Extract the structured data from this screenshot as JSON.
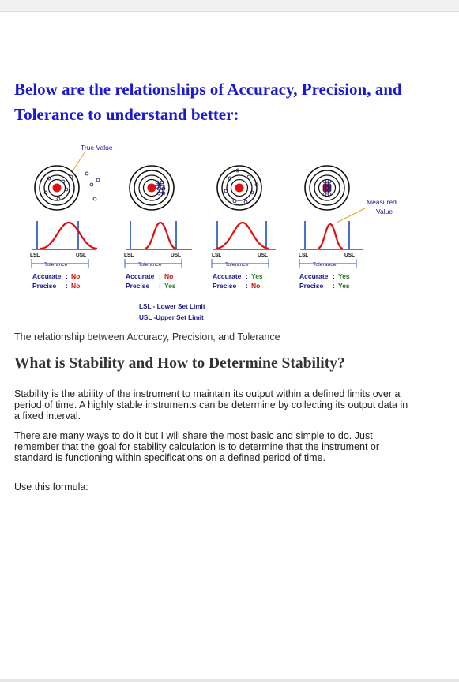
{
  "heading": "Below are the relationships of Accuracy, Precision, and Tolerance to  understand better:",
  "figure": {
    "true_value_label": "True Value",
    "measured_value_label_line1": "Measured",
    "measured_value_label_line2": "Value",
    "lsl": "LSL",
    "usl": "USL",
    "tolerance": "Tolerance",
    "accurate_label": "Accurate",
    "precise_label": "Precise",
    "panels": [
      {
        "accurate": "No",
        "precise": "No"
      },
      {
        "accurate": "No",
        "precise": "Yes"
      },
      {
        "accurate": "Yes",
        "precise": "No"
      },
      {
        "accurate": "Yes",
        "precise": "Yes"
      }
    ],
    "legend_lsl": "LSL - Lower Set Limit",
    "legend_usl": "USL -Upper Set Limit",
    "colors": {
      "yes": "#1e7a1e",
      "no": "#cc1111",
      "label": "#1a1a8c",
      "curve": "#e01010",
      "axis": "#1a4fbf",
      "annotation": "#f0a020"
    }
  },
  "caption": "The relationship between Accuracy, Precision, and Tolerance",
  "subheading": "What is Stability and How to Determine Stability?",
  "paragraphs": [
    "Stability is the ability of the instrument to maintain its output within a defined limits over a period of time. A highly stable instruments can be determine by collecting its output data in a fixed interval.",
    "There are many ways to do it but I will share the most basic and simple to do. Just remember that the goal for stability calculation is to determine that the instrument or standard is functioning within specifications on a defined period of time.",
    "Use this formula:"
  ]
}
